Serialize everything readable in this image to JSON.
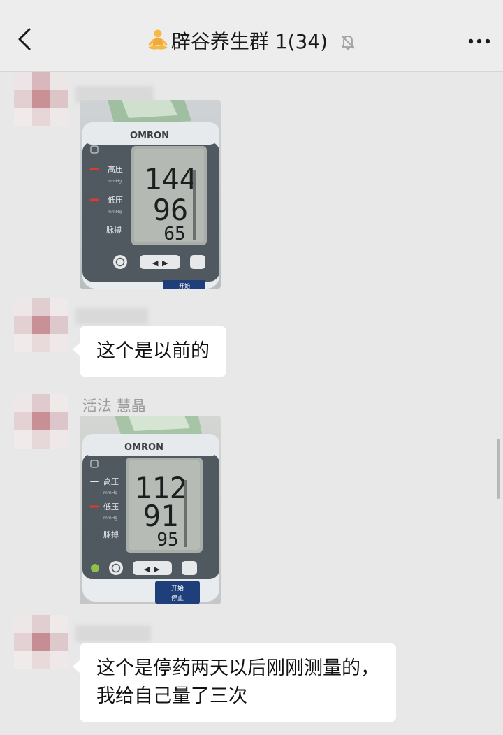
{
  "header": {
    "title": "辟谷养生群 1(34)",
    "title_icon": "meditation-emoji-icon",
    "back_icon": "chevron-left-icon",
    "mute_icon": "bell-off-icon",
    "more_icon": "more-dots-icon"
  },
  "messages": [
    {
      "type": "image",
      "sender": "",
      "device_brand": "OMRON",
      "systolic_label": "高压",
      "diastolic_label": "低压",
      "pulse_label": "脉搏",
      "unit": "mmHg",
      "systolic": "144",
      "diastolic": "96",
      "pulse": "65",
      "start_button": "开始"
    },
    {
      "type": "text",
      "sender": "",
      "text": "这个是以前的"
    },
    {
      "type": "image",
      "sender": "活法 慧晶",
      "device_brand": "OMRON",
      "systolic_label": "高压",
      "diastolic_label": "低压",
      "pulse_label": "脉搏",
      "unit": "mmHg",
      "systolic": "112",
      "diastolic": "91",
      "pulse": "95",
      "start_button": "开始",
      "stop_button": "停止"
    },
    {
      "type": "text",
      "sender": "",
      "text_line1": "这个是停药两天以后刚刚测量的，",
      "text_line2": "我给自己量了三次"
    }
  ],
  "colors": {
    "background": "#e8e8e8",
    "header": "#ededed",
    "bubble": "#ffffff",
    "led_red": "#e03a2a"
  }
}
